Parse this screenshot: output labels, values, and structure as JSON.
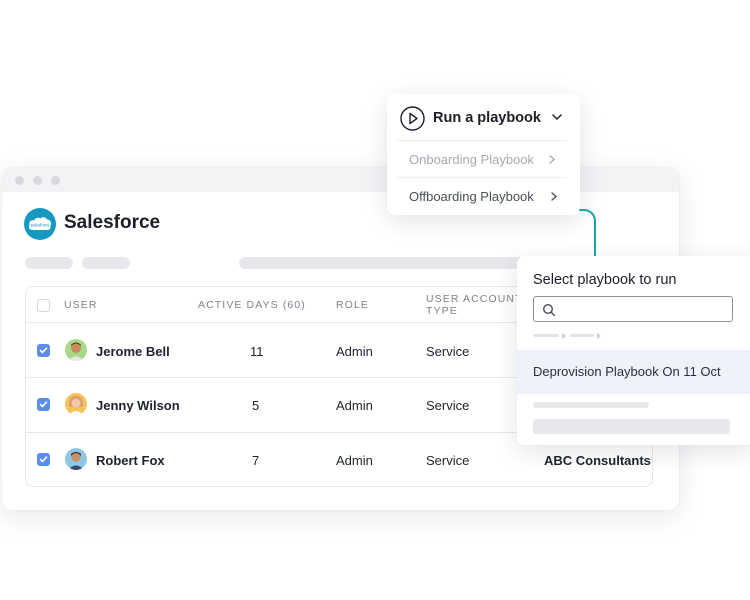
{
  "app": {
    "title": "Salesforce",
    "logo_text": "salesforce"
  },
  "table": {
    "headers": [
      "USER",
      "ACTIVE DAYS (60)",
      "ROLE",
      "USER ACCOUNT TYPE"
    ],
    "rows": [
      {
        "checked": true,
        "name": "Jerome Bell",
        "active_days": "11",
        "role": "Admin",
        "account_type": "Service"
      },
      {
        "checked": true,
        "name": "Jenny Wilson",
        "active_days": "5",
        "role": "Admin",
        "account_type": "Service"
      },
      {
        "checked": true,
        "name": "Robert Fox",
        "active_days": "7",
        "role": "Admin",
        "account_type": "Service",
        "extra": "ABC Consultants"
      }
    ]
  },
  "run_menu": {
    "title": "Run a playbook",
    "items": [
      {
        "label": "Onboarding Playbook"
      },
      {
        "label": "Offboarding Playbook"
      }
    ]
  },
  "select_panel": {
    "title": "Select playbook to run",
    "search_placeholder": "",
    "highlighted_item": "Deprovision Playbook On 11 Oct"
  },
  "colors": {
    "checkbox": "#5b8def",
    "salesforce_blue": "#1798c1",
    "connector_teal": "#1aa6a6",
    "highlight_bg": "#eef3fb"
  },
  "icons": [
    "salesforce-logo",
    "play-circle-icon",
    "chevron-down-icon",
    "chevron-right-icon",
    "search-icon",
    "checkbox-icon"
  ]
}
